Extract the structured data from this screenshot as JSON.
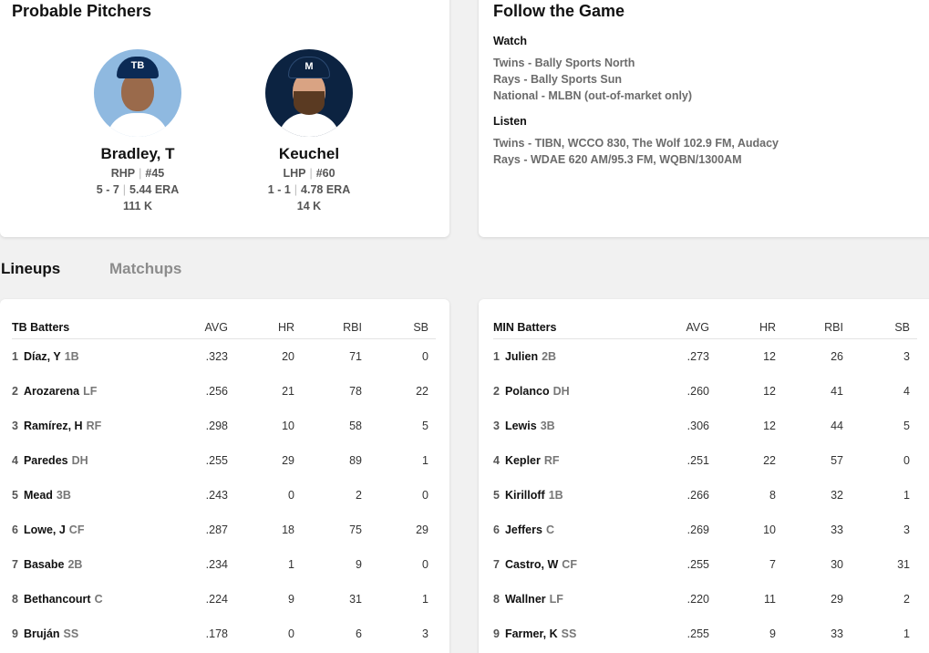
{
  "probable_pitchers": {
    "title": "Probable Pitchers",
    "away": {
      "logo": "TB",
      "name": "Bradley, T",
      "throws": "RHP",
      "number": "#45",
      "record": "5 - 7",
      "era": "5.44 ERA",
      "strikeouts": "111 K"
    },
    "home": {
      "logo": "M",
      "name": "Keuchel",
      "throws": "LHP",
      "number": "#60",
      "record": "1 - 1",
      "era": "4.78 ERA",
      "strikeouts": "14 K"
    }
  },
  "follow_the_game": {
    "title": "Follow the Game",
    "watch": {
      "heading": "Watch",
      "items": [
        "Twins - Bally Sports North",
        "Rays - Bally Sports Sun",
        "National - MLBN (out-of-market only)"
      ]
    },
    "listen": {
      "heading": "Listen",
      "items": [
        "Twins - TIBN, WCCO 830, The Wolf 102.9 FM, Audacy",
        "Rays - WDAE 620 AM/95.3 FM, WQBN/1300AM"
      ]
    }
  },
  "tabs": {
    "lineups": "Lineups",
    "matchups": "Matchups"
  },
  "columns": {
    "avg": "AVG",
    "hr": "HR",
    "rbi": "RBI",
    "sb": "SB"
  },
  "tb_lineup": {
    "header": "TB Batters",
    "batters": [
      {
        "num": "1",
        "name": "Díaz, Y",
        "pos": "1B",
        "avg": ".323",
        "hr": "20",
        "rbi": "71",
        "sb": "0"
      },
      {
        "num": "2",
        "name": "Arozarena",
        "pos": "LF",
        "avg": ".256",
        "hr": "21",
        "rbi": "78",
        "sb": "22"
      },
      {
        "num": "3",
        "name": "Ramírez, H",
        "pos": "RF",
        "avg": ".298",
        "hr": "10",
        "rbi": "58",
        "sb": "5"
      },
      {
        "num": "4",
        "name": "Paredes",
        "pos": "DH",
        "avg": ".255",
        "hr": "29",
        "rbi": "89",
        "sb": "1"
      },
      {
        "num": "5",
        "name": "Mead",
        "pos": "3B",
        "avg": ".243",
        "hr": "0",
        "rbi": "2",
        "sb": "0"
      },
      {
        "num": "6",
        "name": "Lowe, J",
        "pos": "CF",
        "avg": ".287",
        "hr": "18",
        "rbi": "75",
        "sb": "29"
      },
      {
        "num": "7",
        "name": "Basabe",
        "pos": "2B",
        "avg": ".234",
        "hr": "1",
        "rbi": "9",
        "sb": "0"
      },
      {
        "num": "8",
        "name": "Bethancourt",
        "pos": "C",
        "avg": ".224",
        "hr": "9",
        "rbi": "31",
        "sb": "1"
      },
      {
        "num": "9",
        "name": "Bruján",
        "pos": "SS",
        "avg": ".178",
        "hr": "0",
        "rbi": "6",
        "sb": "3"
      }
    ]
  },
  "min_lineup": {
    "header": "MIN Batters",
    "batters": [
      {
        "num": "1",
        "name": "Julien",
        "pos": "2B",
        "avg": ".273",
        "hr": "12",
        "rbi": "26",
        "sb": "3"
      },
      {
        "num": "2",
        "name": "Polanco",
        "pos": "DH",
        "avg": ".260",
        "hr": "12",
        "rbi": "41",
        "sb": "4"
      },
      {
        "num": "3",
        "name": "Lewis",
        "pos": "3B",
        "avg": ".306",
        "hr": "12",
        "rbi": "44",
        "sb": "5"
      },
      {
        "num": "4",
        "name": "Kepler",
        "pos": "RF",
        "avg": ".251",
        "hr": "22",
        "rbi": "57",
        "sb": "0"
      },
      {
        "num": "5",
        "name": "Kirilloff",
        "pos": "1B",
        "avg": ".266",
        "hr": "8",
        "rbi": "32",
        "sb": "1"
      },
      {
        "num": "6",
        "name": "Jeffers",
        "pos": "C",
        "avg": ".269",
        "hr": "10",
        "rbi": "33",
        "sb": "3"
      },
      {
        "num": "7",
        "name": "Castro, W",
        "pos": "CF",
        "avg": ".255",
        "hr": "7",
        "rbi": "30",
        "sb": "31"
      },
      {
        "num": "8",
        "name": "Wallner",
        "pos": "LF",
        "avg": ".220",
        "hr": "11",
        "rbi": "29",
        "sb": "2"
      },
      {
        "num": "9",
        "name": "Farmer, K",
        "pos": "SS",
        "avg": ".255",
        "hr": "9",
        "rbi": "33",
        "sb": "1"
      }
    ]
  }
}
